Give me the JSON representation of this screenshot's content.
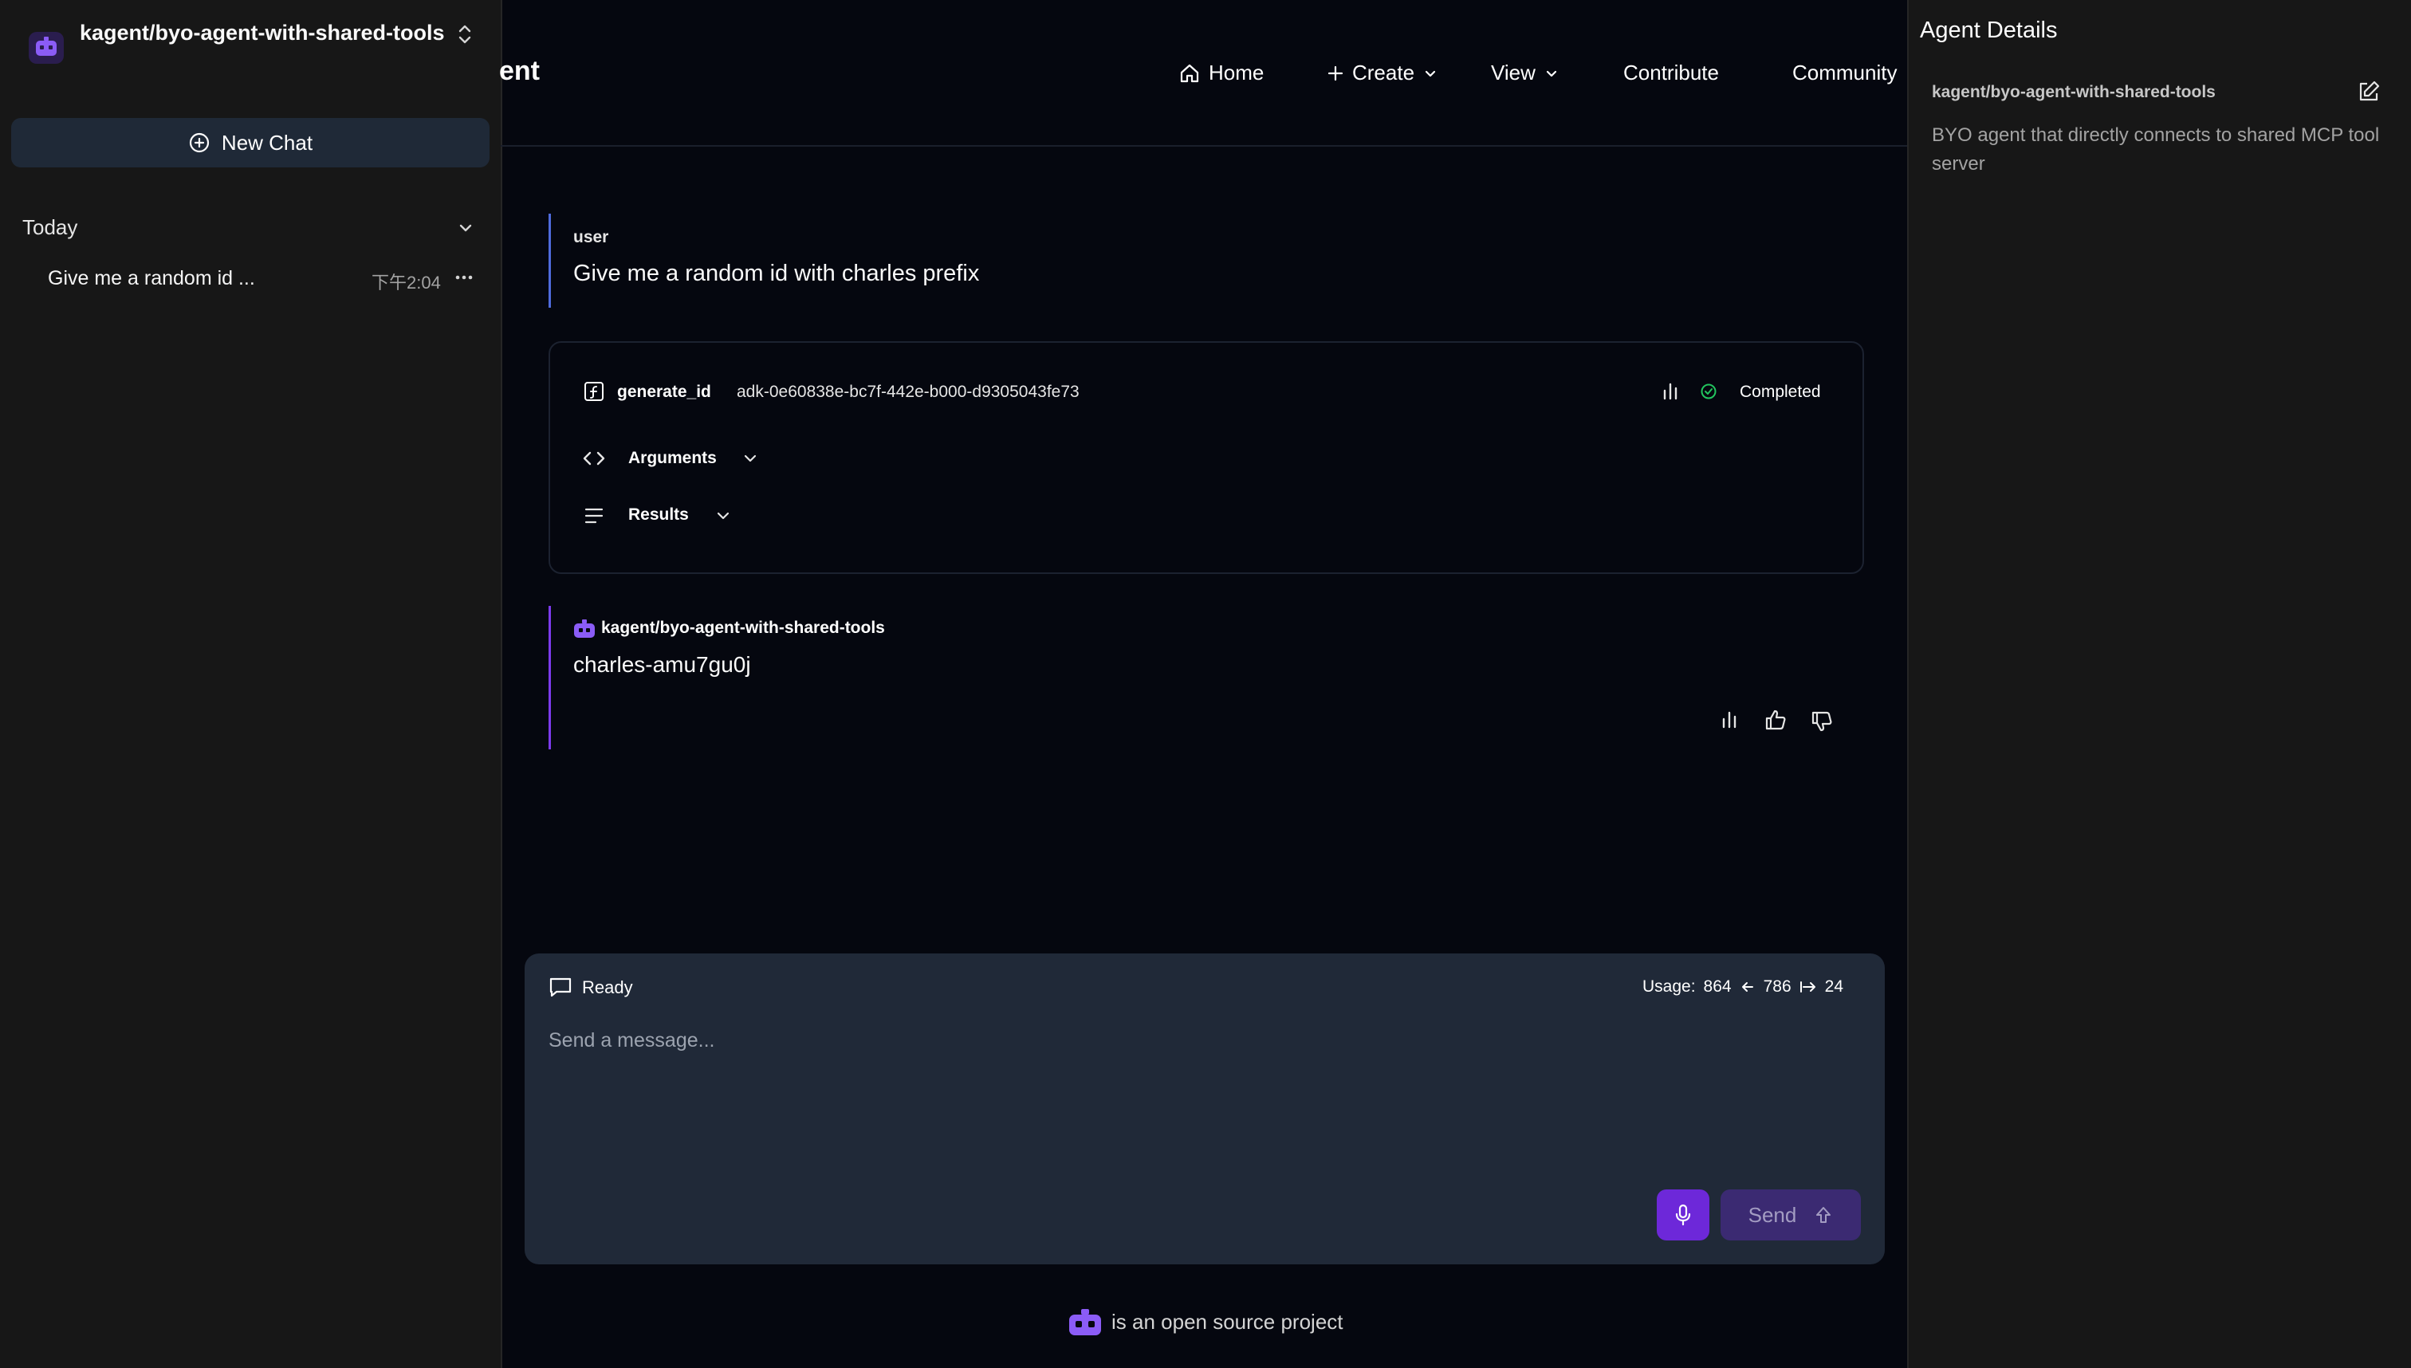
{
  "sidebar": {
    "agent_name": "kagent/byo-agent-with-shared-tools",
    "new_chat_label": "New Chat",
    "section_label": "Today",
    "chats": [
      {
        "title": "Give me a random id ...",
        "time": "下午2:04"
      }
    ]
  },
  "header": {
    "brand_partial": "ent",
    "nav": {
      "home": "Home",
      "create": "Create",
      "view": "View",
      "contribute": "Contribute",
      "community": "Community"
    }
  },
  "chat": {
    "user_role": "user",
    "user_text": "Give me a random id with charles prefix",
    "tool_call": {
      "name": "generate_id",
      "id": "adk-0e60838e-bc7f-442e-b000-d9305043fe73",
      "status": "Completed",
      "arguments_label": "Arguments",
      "results_label": "Results"
    },
    "agent_role": "kagent/byo-agent-with-shared-tools",
    "agent_text": "charles-amu7gu0j"
  },
  "input": {
    "status": "Ready",
    "usage_label": "Usage:",
    "usage_total": "864",
    "usage_in": "786",
    "usage_out": "24",
    "placeholder": "Send a message...",
    "send_label": "Send"
  },
  "footer": {
    "text": "is an open source project"
  },
  "details": {
    "title": "Agent Details",
    "name": "kagent/byo-agent-with-shared-tools",
    "description": "BYO agent that directly connects to shared MCP tool server"
  },
  "colors": {
    "accent": "#6d28d9",
    "user_border": "#4f6bdc",
    "agent_border": "#7c3aed",
    "success": "#22c55e"
  },
  "icons": [
    "robot-icon",
    "updown-chevron-icon",
    "plus-circle-icon",
    "chevron-down-icon",
    "more-icon",
    "home-icon",
    "plus-icon",
    "function-icon",
    "chart-icon",
    "check-circle-icon",
    "code-icon",
    "list-icon",
    "thumbs-up-icon",
    "thumbs-down-icon",
    "message-icon",
    "arrow-left-icon",
    "arrow-right-icon",
    "mic-icon",
    "arrow-up-icon",
    "edit-icon"
  ]
}
